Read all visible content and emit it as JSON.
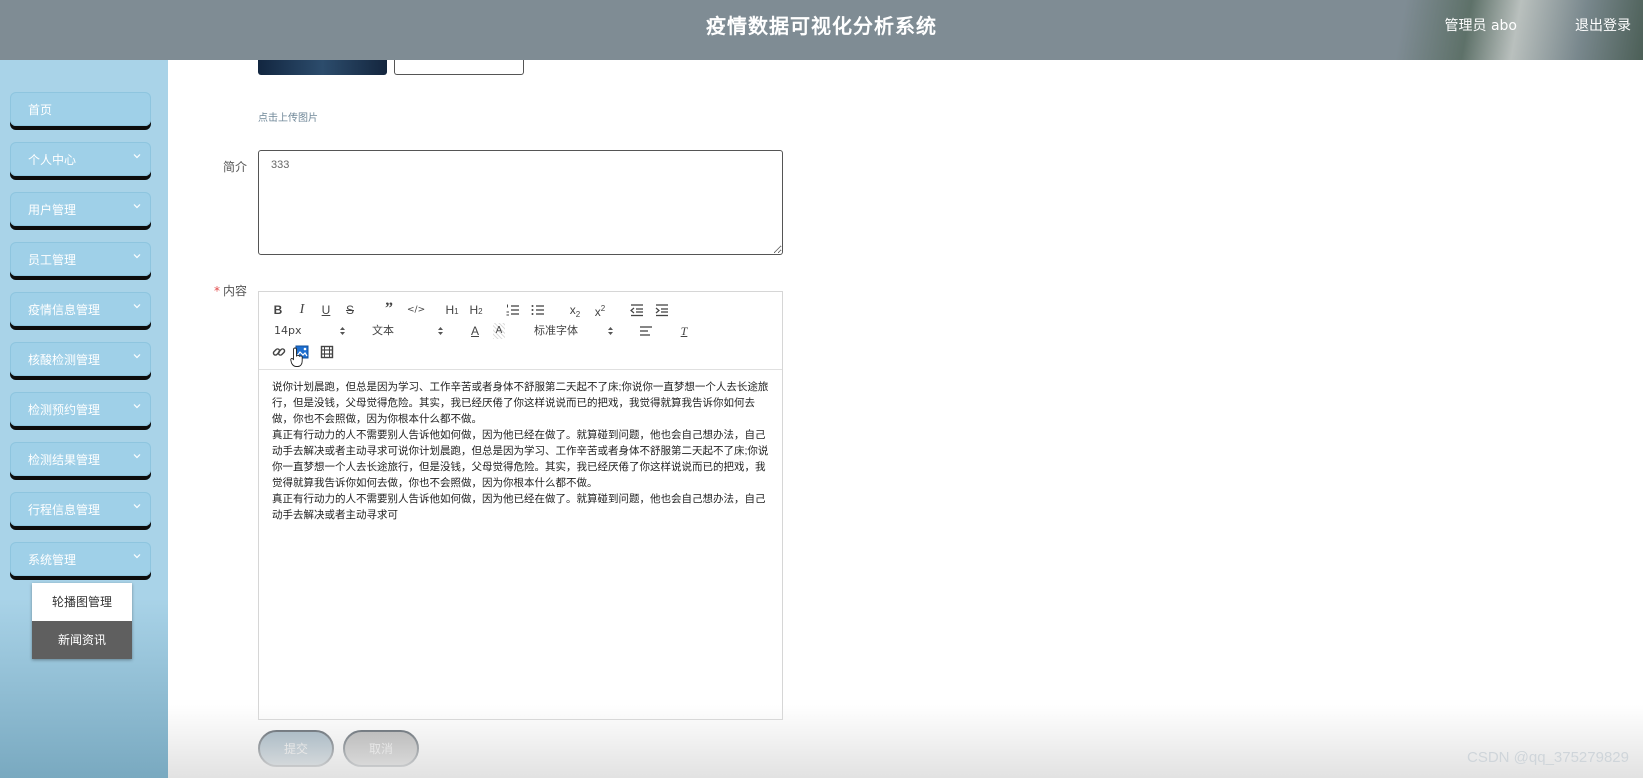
{
  "header": {
    "title": "疫情数据可视化分析系统",
    "user": "管理员 abo",
    "logout": "退出登录"
  },
  "sidebar": {
    "items": [
      {
        "label": "首页",
        "has_chevron": false
      },
      {
        "label": "个人中心",
        "has_chevron": true
      },
      {
        "label": "用户管理",
        "has_chevron": true
      },
      {
        "label": "员工管理",
        "has_chevron": true
      },
      {
        "label": "疫情信息管理",
        "has_chevron": true
      },
      {
        "label": "核酸检测管理",
        "has_chevron": true
      },
      {
        "label": "检测预约管理",
        "has_chevron": true
      },
      {
        "label": "检测结果管理",
        "has_chevron": true
      },
      {
        "label": "行程信息管理",
        "has_chevron": true
      },
      {
        "label": "系统管理",
        "has_chevron": true
      }
    ],
    "submenu": [
      {
        "label": "轮播图管理",
        "active": false
      },
      {
        "label": "新闻资讯",
        "active": true
      }
    ]
  },
  "form": {
    "upload_hint": "点击上传图片",
    "intro_label": "简介",
    "intro_value": "333",
    "content_label": "内容",
    "content_required_mark": "*",
    "toolbar": {
      "font_size": "14px",
      "header_select": "文本",
      "font_family": "标准字体"
    },
    "content_paragraphs": [
      "说你计划晨跑，但总是因为学习、工作辛苦或者身体不舒服第二天起不了床;你说你一直梦想一个人去长途旅行，但是没钱，父母觉得危险。其实，我已经厌倦了你这样说说而已的把戏，我觉得就算我告诉你如何去做，你也不会照做，因为你根本什么都不做。",
      "真正有行动力的人不需要别人告诉他如何做，因为他已经在做了。就算碰到问题，他也会自己想办法，自己动手去解决或者主动寻求可说你计划晨跑，但总是因为学习、工作辛苦或者身体不舒服第二天起不了床;你说你一直梦想一个人去长途旅行，但是没钱，父母觉得危险。其实，我已经厌倦了你这样说说而已的把戏，我觉得就算我告诉你如何去做，你也不会照做，因为你根本什么都不做。",
      "真正有行动力的人不需要别人告诉他如何做，因为他已经在做了。就算碰到问题，他也会自己想办法，自己动手去解决或者主动寻求可"
    ],
    "submit_label": "提交",
    "cancel_label": "取消"
  },
  "watermark": "CSDN @qq_375279829",
  "colors": {
    "header_bg": "#7f8c94",
    "sidebar_bg": "#a9d3e8",
    "menu_item_bg": "#9fd0e8",
    "submenu_active_bg": "#5f5f5f",
    "submit_bg": "#8fa8b8",
    "cancel_bg": "#a9a9a9"
  },
  "icons": [
    "chevron-down-icon",
    "bold-icon",
    "italic-icon",
    "underline-icon",
    "strike-icon",
    "quote-icon",
    "code-icon",
    "h1-icon",
    "h2-icon",
    "ordered-list-icon",
    "bullet-list-icon",
    "subscript-icon",
    "superscript-icon",
    "outdent-icon",
    "indent-icon",
    "font-color-icon",
    "background-color-icon",
    "align-icon",
    "clean-format-icon",
    "link-icon",
    "image-icon",
    "video-icon",
    "hand-cursor-icon"
  ]
}
